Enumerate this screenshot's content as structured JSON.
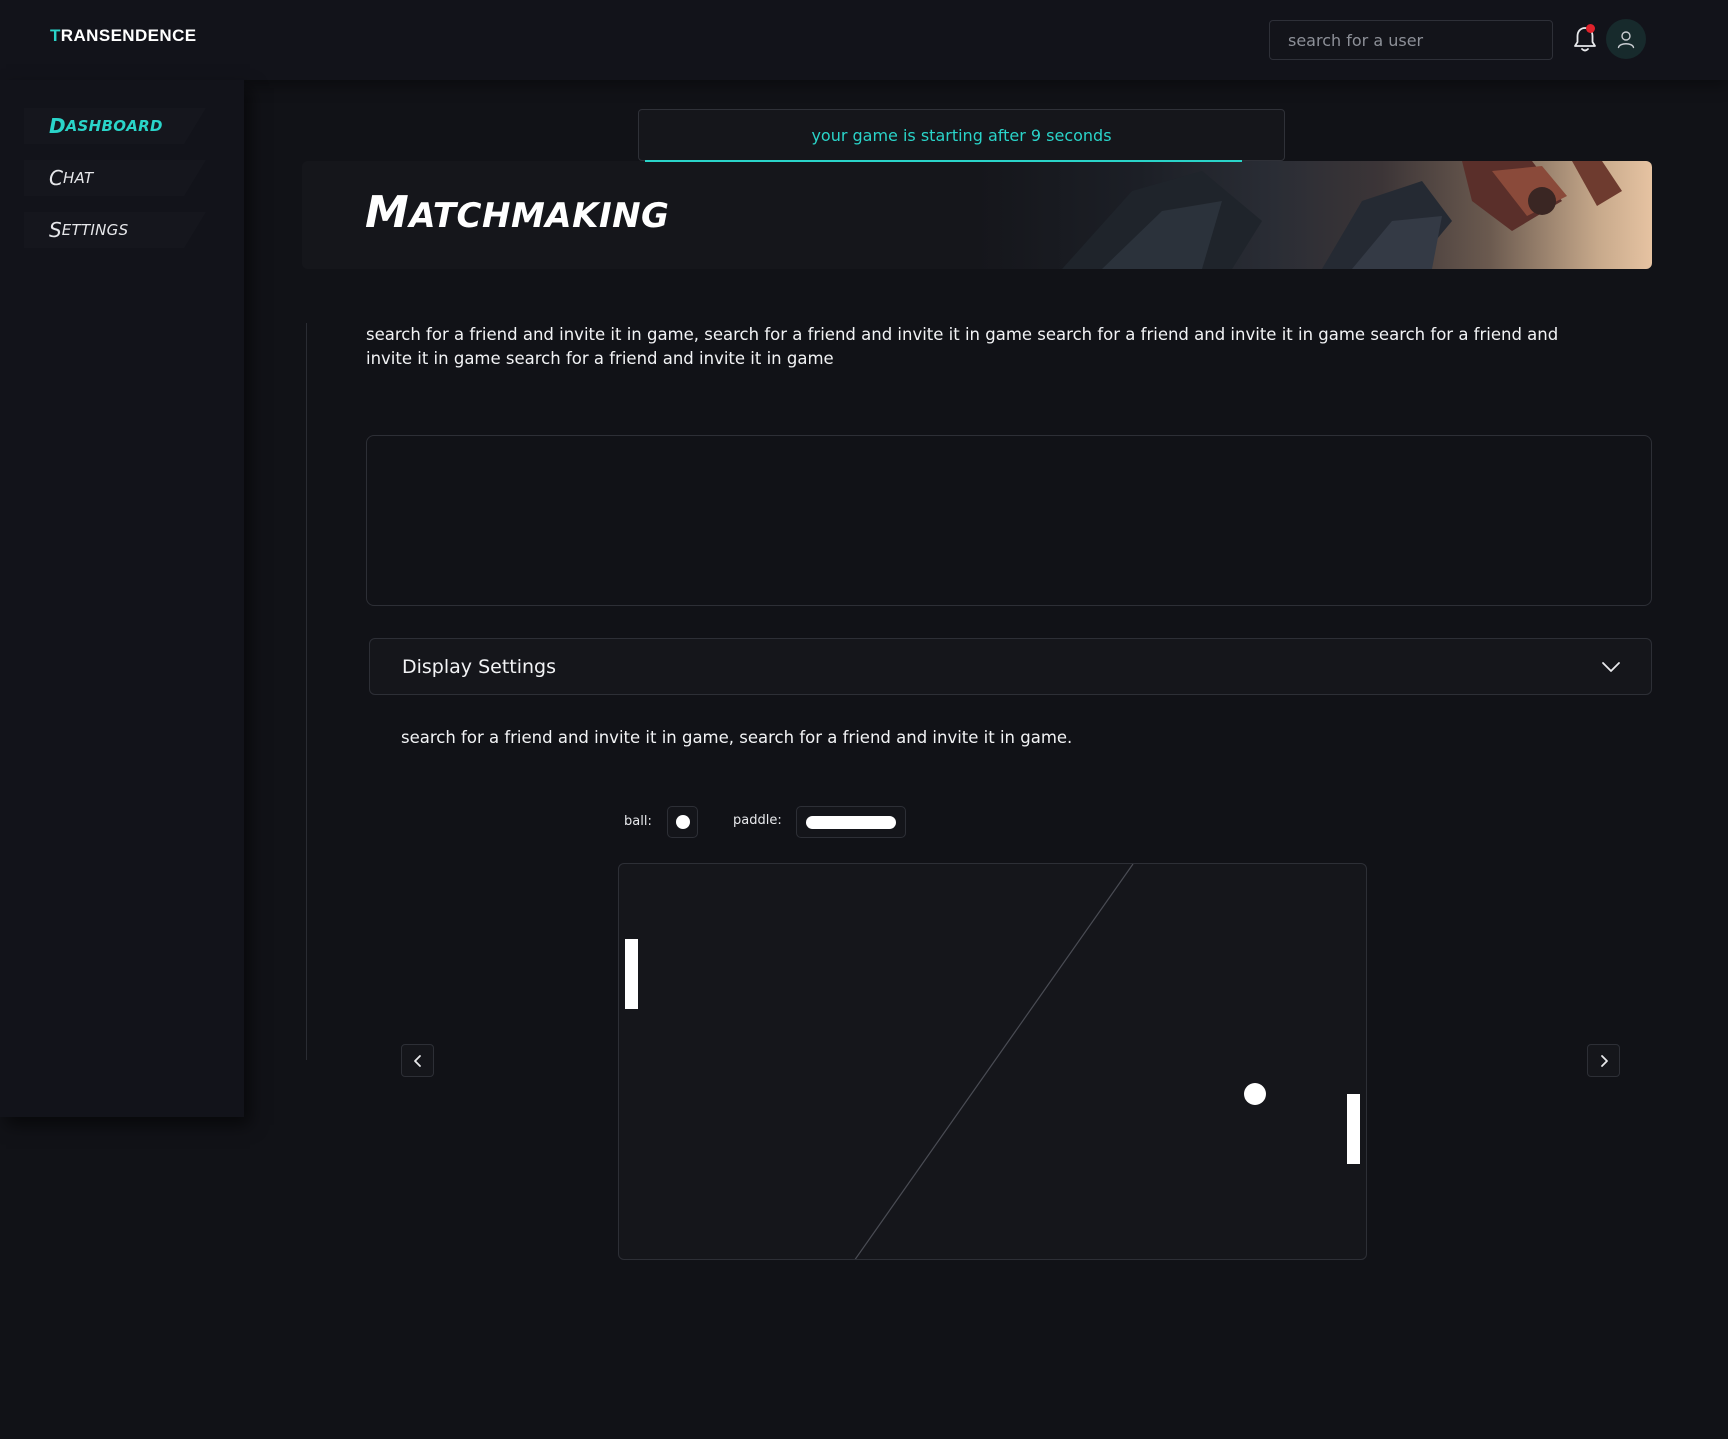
{
  "header": {
    "logo_first": "T",
    "logo_rest": "RANSENDENCE",
    "search_placeholder": "search for a user",
    "notification_icon": "bell-icon",
    "has_unread_notification": true,
    "avatar_icon": "user-icon"
  },
  "sidebar": {
    "items": [
      {
        "first": "D",
        "rest": "ASHBOARD",
        "active": true
      },
      {
        "first": "C",
        "rest": "HAT",
        "active": false
      },
      {
        "first": "S",
        "rest": "ETTINGS",
        "active": false
      }
    ]
  },
  "toast": {
    "message": "your game is starting after 9 seconds"
  },
  "banner": {
    "title_first": "M",
    "title_rest": "ATCHMAKING"
  },
  "main": {
    "description": "search for a friend and invite it in game, search for a friend and invite it in game search for a friend and invite it in game search for a friend and invite it in game search for a friend and invite it in game",
    "display_settings": {
      "title": "Display Settings",
      "description": "search for a friend and invite it in game, search for a friend and invite it in game.",
      "ball_label": "ball:",
      "paddle_label": "paddle:"
    }
  },
  "colors": {
    "accent": "#2ad4c9",
    "background": "#111217",
    "panel": "#15161b",
    "notification_dot": "#e0222b"
  }
}
